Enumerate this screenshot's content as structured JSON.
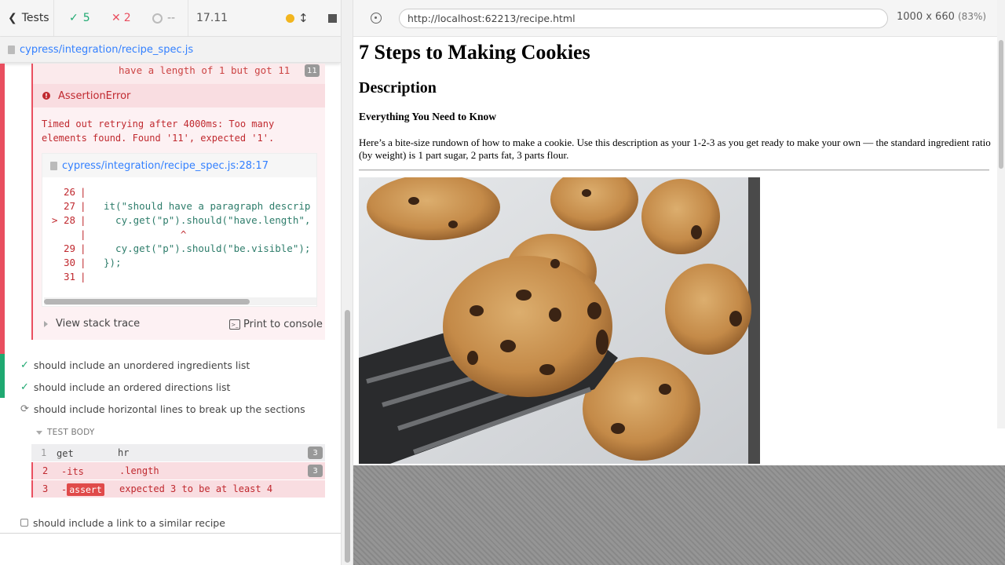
{
  "reporter": {
    "tests_label": "Tests",
    "passed_count": "5",
    "failed_count": "2",
    "pending_count": "--",
    "duration": "17.11",
    "spec_file": "cypress/integration/recipe_spec.js",
    "prev_command": {
      "message": "have a length of 1 but got 11",
      "count": "11"
    },
    "error": {
      "name": "AssertionError",
      "message_line1": "Timed out retrying after 4000ms: Too many",
      "message_line2": "elements found. Found '11', expected '1'.",
      "file_ref": "cypress/integration/recipe_spec.js:28:17",
      "code_lines": [
        {
          "num": "26",
          "bar": "|",
          "code": ""
        },
        {
          "num": "27",
          "bar": "|",
          "code": "it(\"should have a paragraph descrip"
        },
        {
          "num": "> 28",
          "bar": "|",
          "code": "  cy.get(\"p\").should(\"have.length\","
        },
        {
          "num": "",
          "bar": "|",
          "code": "             ^"
        },
        {
          "num": "29",
          "bar": "|",
          "code": "  cy.get(\"p\").should(\"be.visible\");"
        },
        {
          "num": "30",
          "bar": "|",
          "code": "});"
        },
        {
          "num": "31",
          "bar": "|",
          "code": ""
        }
      ],
      "view_stack_trace": "View stack trace",
      "print_to_console": "Print to console"
    },
    "tests": [
      {
        "title": "should include an unordered ingredients list",
        "state": "passed"
      },
      {
        "title": "should include an ordered directions list",
        "state": "passed"
      },
      {
        "title": "should include horizontal lines to break up the sections",
        "state": "running"
      },
      {
        "title": "should include a link to a similar recipe",
        "state": "pending"
      }
    ],
    "test_body_label": "TEST BODY",
    "commands": [
      {
        "num": "1",
        "name": "get",
        "arg": "hr",
        "count": "3"
      },
      {
        "num": "2",
        "name": "-its",
        "arg": ".length",
        "count": "3"
      },
      {
        "num": "3",
        "name": "-",
        "tag": "assert",
        "arg": "expected 3 to be at least 4"
      }
    ]
  },
  "runner": {
    "url": "http://localhost:62213/recipe.html",
    "viewport": "1000 x 660",
    "scale": "(83%)"
  },
  "page": {
    "title": "7 Steps to Making Cookies",
    "subtitle": "Description",
    "section_heading": "Everything You Need to Know",
    "paragraph": "Here’s a bite-size rundown of how to make a cookie. Use this description as your 1-2-3 as you get ready to make your own — the standard ingredient ratio (by weight) is 1 part sugar, 2 parts fat, 3 parts flour."
  },
  "colors": {
    "pass": "#1fa971",
    "fail": "#e94f5f",
    "link": "#3380ff",
    "pending_dot": "#f2b51e"
  }
}
